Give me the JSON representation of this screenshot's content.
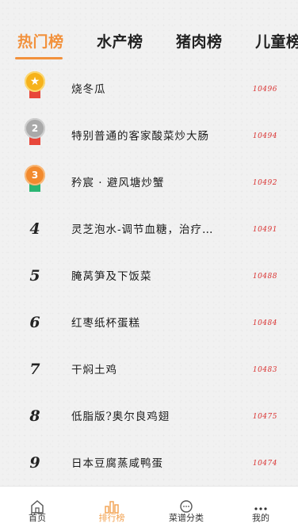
{
  "tabs": [
    {
      "label": "热门榜",
      "active": true
    },
    {
      "label": "水产榜",
      "active": false
    },
    {
      "label": "猪肉榜",
      "active": false
    },
    {
      "label": "儿童榜",
      "active": false
    }
  ],
  "accent_color": "#f2913c",
  "count_color": "#d9302f",
  "ranking": [
    {
      "rank": "1",
      "title": "烧冬瓜",
      "count": "10496",
      "medal": "gold-star"
    },
    {
      "rank": "2",
      "title": "特别普通的客家酸菜炒大肠",
      "count": "10494",
      "medal": "silver"
    },
    {
      "rank": "3",
      "title": "矜宸 · 避风塘炒蟹",
      "count": "10492",
      "medal": "bronze"
    },
    {
      "rank": "4",
      "title": "灵芝泡水-调节血糖，治疗…",
      "count": "10491"
    },
    {
      "rank": "5",
      "title": "腌莴笋及下饭菜",
      "count": "10488"
    },
    {
      "rank": "6",
      "title": "红枣纸杯蛋糕",
      "count": "10484"
    },
    {
      "rank": "7",
      "title": "干焖土鸡",
      "count": "10483"
    },
    {
      "rank": "8",
      "title": "低脂版?奥尔良鸡翅",
      "count": "10475"
    },
    {
      "rank": "9",
      "title": "日本豆腐蒸咸鸭蛋",
      "count": "10474"
    }
  ],
  "bottom_nav": [
    {
      "label": "首页",
      "icon": "home-icon",
      "active": false
    },
    {
      "label": "排行榜",
      "icon": "ranking-icon",
      "active": true
    },
    {
      "label": "菜谱分类",
      "icon": "category-icon",
      "active": false
    },
    {
      "label": "我的",
      "icon": "more-icon",
      "active": false
    }
  ]
}
